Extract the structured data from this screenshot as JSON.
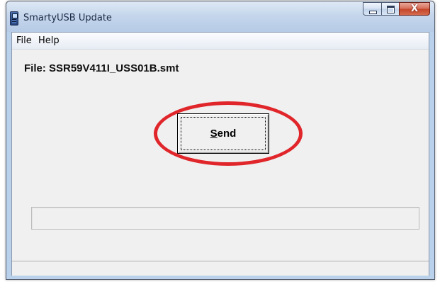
{
  "window": {
    "title": "SmartyUSB Update",
    "caption": {
      "close_glyph": "X"
    }
  },
  "menu": {
    "items": [
      "File",
      "Help"
    ]
  },
  "main": {
    "file_label": "File: SSR59V411I_USS01B.smt",
    "send_button": {
      "mnemonic": "S",
      "rest": "end"
    },
    "progress": {
      "value": 0
    },
    "status_text": ""
  },
  "colors": {
    "highlight": "#e0262a",
    "titlebar": "#c5d6ec",
    "client_bg": "#f0f0f0"
  },
  "icons": [
    "app-icon",
    "minimize-icon",
    "maximize-icon",
    "close-icon"
  ]
}
